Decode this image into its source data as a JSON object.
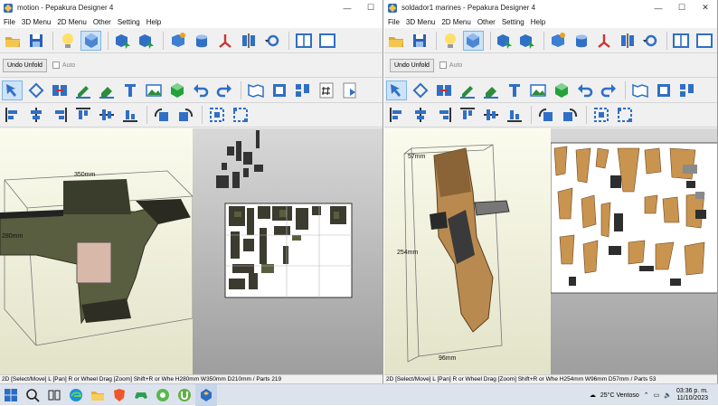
{
  "windows": [
    {
      "title": "motion - Pepakura Designer 4",
      "menus": [
        "File",
        "3D Menu",
        "2D Menu",
        "Other",
        "Setting",
        "Help"
      ],
      "undo_unfold": "Undo Unfold",
      "auto": "Auto",
      "dims": {
        "width": "350mm",
        "height": "280mm"
      },
      "status": "2D [Select/Move] L [Pan] R or Wheel Drag [Zoom] Shift+R or Whe H280mm W350mm D210mm / Parts 219"
    },
    {
      "title": "soldador1 marines - Pepakura Designer 4",
      "menus": [
        "File",
        "3D Menu",
        "2D Menu",
        "Other",
        "Setting",
        "Help"
      ],
      "undo_unfold": "Undo Unfold",
      "auto": "Auto",
      "dims": {
        "depth": "57mm",
        "height": "254mm",
        "width": "96mm"
      },
      "status": "2D [Select/Move] L [Pan] R or Wheel Drag [Zoom] Shift+R or Whe H254mm W96mm D57mm / Parts 53"
    }
  ],
  "window_controls": {
    "minimize": "—",
    "maximize": "☐",
    "close": "✕"
  },
  "taskbar": {
    "icons": [
      "windows-start-icon",
      "search-icon",
      "task-view-icon",
      "edge-icon",
      "file-explorer-icon",
      "brave-icon",
      "game-icon",
      "green-app-icon",
      "utorrent-icon",
      "pepakura-icon"
    ],
    "weather": "25°C  Ventoso",
    "time": "03:36 p. m.",
    "date": "11/10/2023"
  },
  "colors": {
    "accent": "#2b6cc4",
    "view3d_bg": "#f2f2dd",
    "view2d_bg": "#b8b8b8"
  }
}
